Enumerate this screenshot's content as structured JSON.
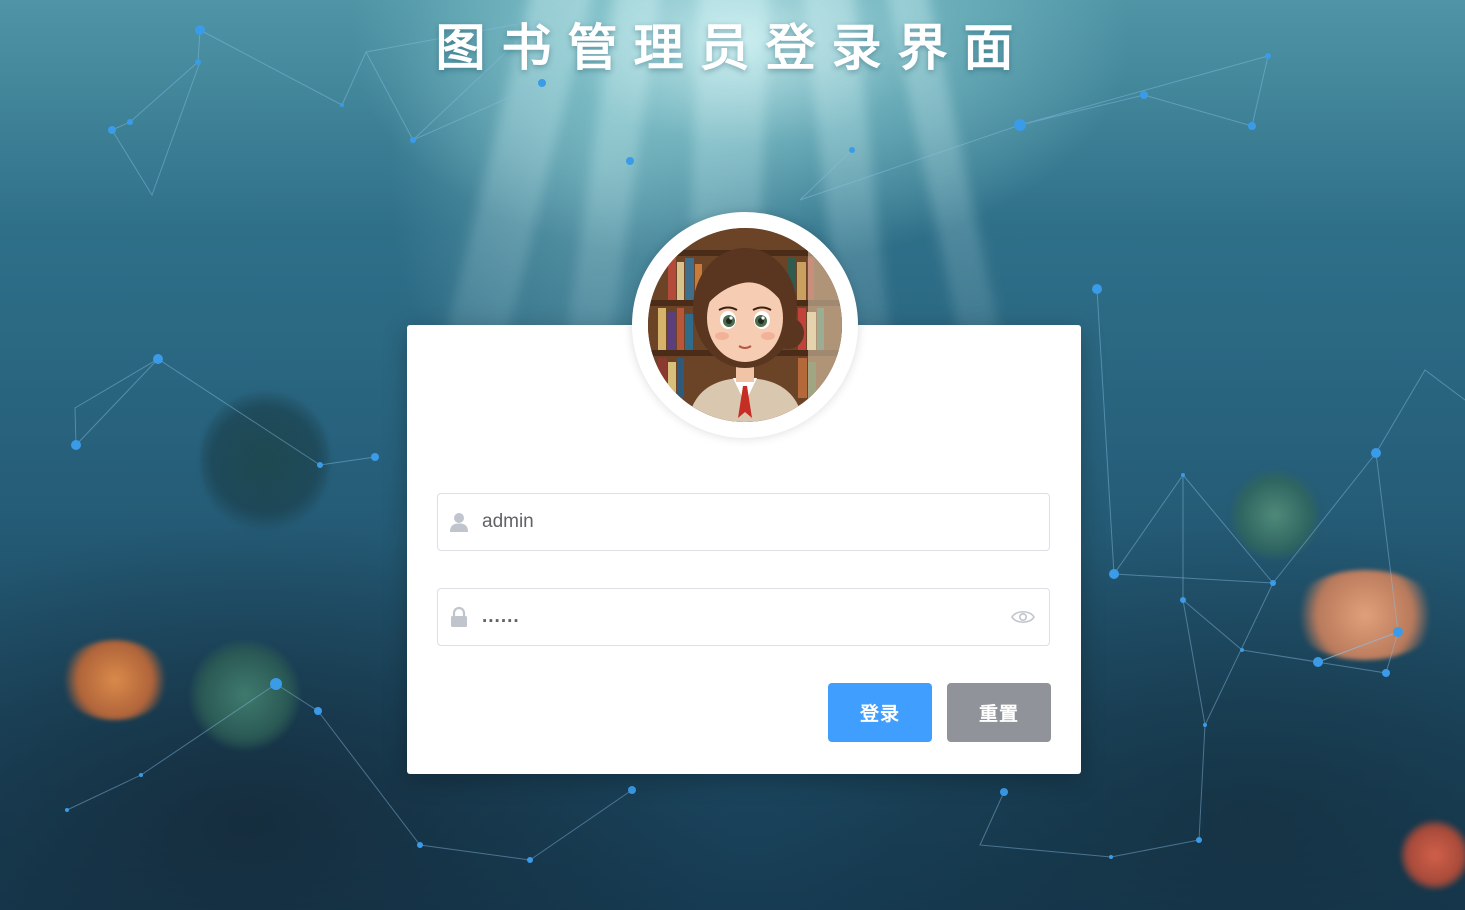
{
  "title": "图书管理员登录界面",
  "login_form": {
    "username": {
      "value": "admin",
      "icon": "user-icon"
    },
    "password": {
      "value": "......",
      "icon": "lock-icon",
      "toggle_icon": "eye-icon"
    },
    "avatar": {
      "icon": "librarian-avatar"
    }
  },
  "buttons": {
    "login_label": "登录",
    "reset_label": "重置"
  },
  "colors": {
    "primary": "#409eff",
    "info": "#909399",
    "card_bg": "#ffffff",
    "title_text": "#ffffff"
  }
}
